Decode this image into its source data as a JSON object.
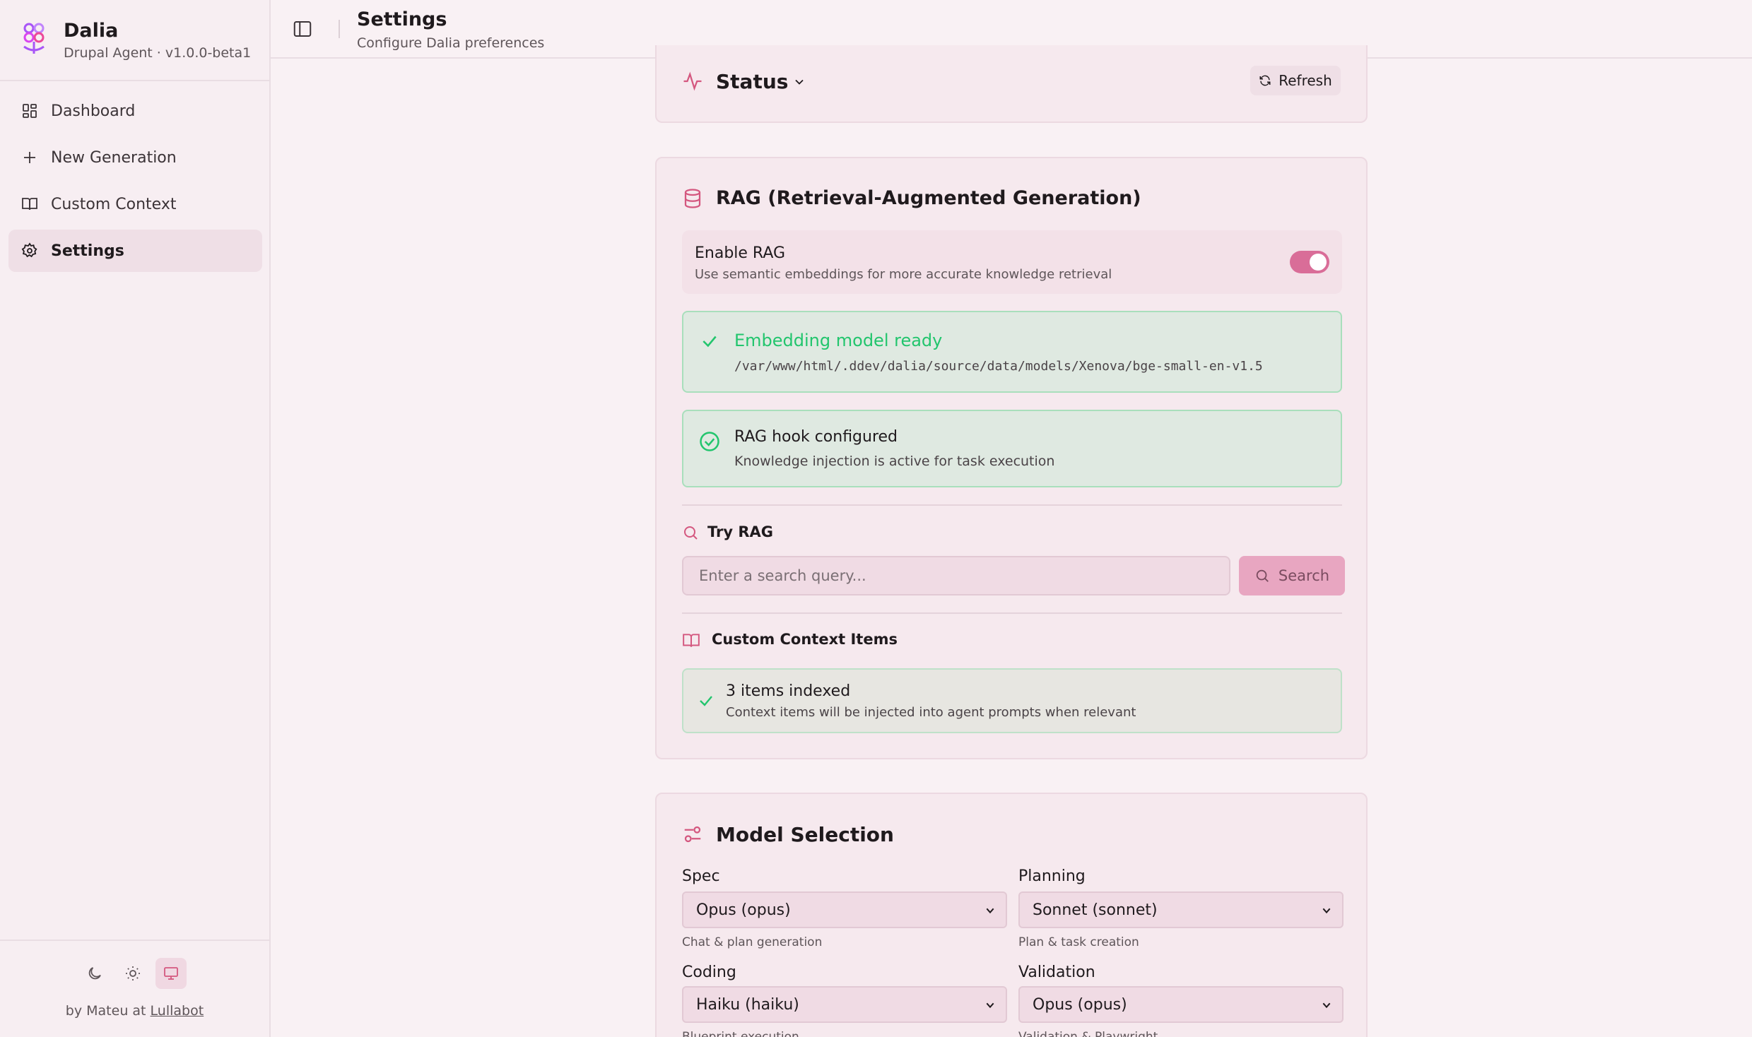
{
  "app": {
    "name": "Dalia",
    "subtitle": "Drupal Agent · v1.0.0-beta1"
  },
  "sidebar": {
    "items": [
      {
        "label": "Dashboard",
        "icon": "dashboard-icon"
      },
      {
        "label": "New Generation",
        "icon": "plus-icon"
      },
      {
        "label": "Custom Context",
        "icon": "book-icon"
      },
      {
        "label": "Settings",
        "icon": "gear-icon",
        "active": true
      }
    ],
    "theme_modes": [
      "moon-icon",
      "sun-icon",
      "monitor-icon"
    ],
    "active_theme": "monitor-icon",
    "credit_prefix": "by Mateu at",
    "credit_link": "Lullabot"
  },
  "header": {
    "title": "Settings",
    "subtitle": "Configure Dalia preferences"
  },
  "status": {
    "title": "Status",
    "refresh_label": "Refresh"
  },
  "rag": {
    "title": "RAG (Retrieval-Augmented Generation)",
    "enable_label": "Enable RAG",
    "enable_desc": "Use semantic embeddings for more accurate knowledge retrieval",
    "enabled": true,
    "embedding_title": "Embedding model ready",
    "embedding_path": "/var/www/html/.ddev/dalia/source/data/models/Xenova/bge-small-en-v1.5",
    "hook_title": "RAG hook configured",
    "hook_desc": "Knowledge injection is active for task execution",
    "try_label": "Try RAG",
    "search_placeholder": "Enter a search query...",
    "search_label": "Search",
    "context_label": "Custom Context Items",
    "indexed_title": "3 items indexed",
    "indexed_desc": "Context items will be injected into agent prompts when relevant"
  },
  "models": {
    "title": "Model Selection",
    "fields": [
      {
        "label": "Spec",
        "value": "Opus (opus)",
        "hint": "Chat & plan generation"
      },
      {
        "label": "Planning",
        "value": "Sonnet (sonnet)",
        "hint": "Plan & task creation"
      },
      {
        "label": "Coding",
        "value": "Haiku (haiku)",
        "hint": "Blueprint execution"
      },
      {
        "label": "Validation",
        "value": "Opus (opus)",
        "hint": "Validation & Playwright"
      }
    ]
  },
  "colors": {
    "accent": "#d96d98",
    "success": "#22c56d",
    "background": "#f9f1f4"
  }
}
